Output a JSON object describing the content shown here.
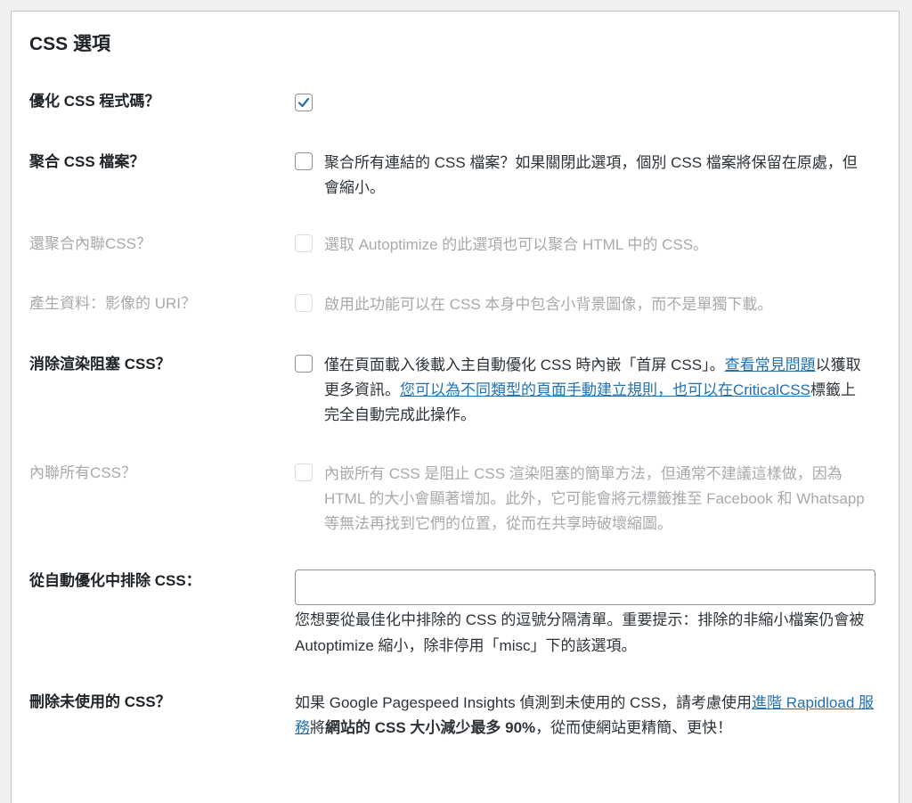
{
  "section": {
    "title": "CSS 選項"
  },
  "rows": [
    {
      "label": "優化 CSS 程式碼？",
      "checked": true,
      "disabled": false,
      "desc": ""
    },
    {
      "label": "聚合 CSS 檔案？",
      "checked": false,
      "disabled": false,
      "desc": "聚合所有連結的 CSS 檔案？如果關閉此選項，個別 CSS 檔案將保留在原處，但會縮小。"
    },
    {
      "label": "還聚合內聯CSS？",
      "checked": false,
      "disabled": true,
      "desc": "選取 Autoptimize 的此選項也可以聚合 HTML 中的 CSS。"
    },
    {
      "label": "產生資料：影像的 URI？",
      "checked": false,
      "disabled": true,
      "desc": "啟用此功能可以在 CSS 本身中包含小背景圖像，而不是單獨下載。"
    },
    {
      "label": "消除渲染阻塞 CSS？",
      "checked": false,
      "disabled": false,
      "desc_pre": "僅在頁面載入後載入主自動優化 CSS 時內嵌「首屏 CSS」。",
      "link1": "查看常見問題",
      "desc_mid": "以獲取更多資訊。",
      "link2": "您可以為不同類型的頁面手動建立規則，也可以在CriticalCSS",
      "desc_post": "標籤上完全自動完成此操作。"
    },
    {
      "label": "內聯所有CSS？",
      "checked": false,
      "disabled": true,
      "desc": "內嵌所有 CSS 是阻止 CSS 渲染阻塞的簡單方法，但通常不建議這樣做，因為 HTML 的大小會顯著增加。此外，它可能會將元標籤推至 Facebook 和 Whatsapp 等無法再找到它們的位置，從而在共享時破壞縮圖。"
    }
  ],
  "exclude": {
    "label": "從自動優化中排除 CSS：",
    "value": "",
    "note": "您想要從最佳化中排除的 CSS 的逗號分隔清單。重要提示：排除的非縮小檔案仍會被 Autoptimize 縮小，除非停用「misc」下的該選項。"
  },
  "unused": {
    "label": "刪除未使用的 CSS？",
    "desc_pre": "如果 Google Pagespeed Insights 偵測到未使用的 CSS，請考慮使用",
    "link": "進階 Rapidload 服務",
    "desc_mid": "將",
    "bold": "網站的 CSS 大小減少最多 90%",
    "desc_post": "，從而使網站更精簡、更快！"
  },
  "colors": {
    "link": "#2271b1",
    "check": "#2271b1",
    "disabled": "#a7aaad"
  }
}
